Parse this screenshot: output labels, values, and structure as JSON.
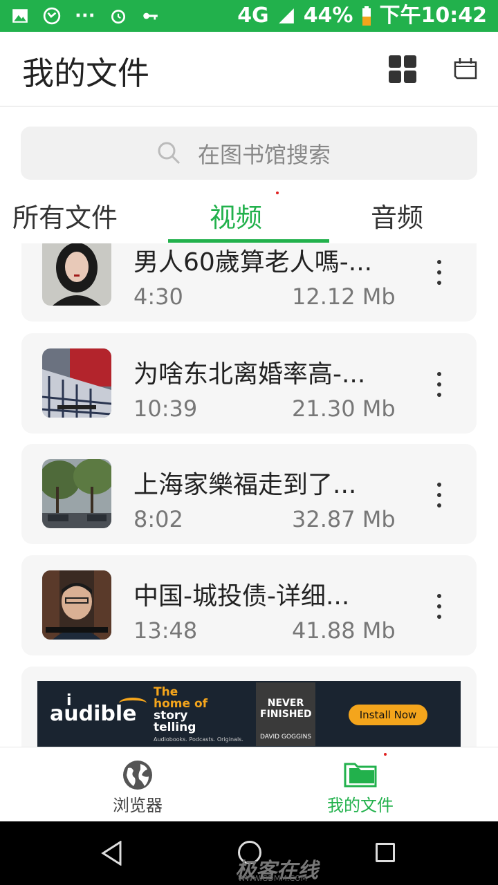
{
  "status_bar": {
    "network": "4G",
    "battery": "44%",
    "time": "下午10:42",
    "icons": [
      "image-icon",
      "phone-icon",
      "more-dots-icon",
      "alarm-icon",
      "key-icon",
      "signal-icon",
      "battery-icon"
    ],
    "color": "#22b14c"
  },
  "app_bar": {
    "title": "我的文件",
    "icons": [
      "grid-view-icon",
      "calendar-icon"
    ]
  },
  "search": {
    "placeholder": "在图书馆搜索",
    "icon": "search-icon"
  },
  "tabs": [
    {
      "label": "所有文件",
      "active": false
    },
    {
      "label": "视频",
      "active": true
    },
    {
      "label": "音频",
      "active": false
    }
  ],
  "files": [
    {
      "name": "男人60歲算老人嗎-...",
      "duration": "4:30",
      "size": "12.12 Mb"
    },
    {
      "name": "为啥东北离婚率高-...",
      "duration": "10:39",
      "size": "21.30 Mb"
    },
    {
      "name": "上海家樂福走到了...",
      "duration": "8:02",
      "size": "32.87 Mb"
    },
    {
      "name": "中国-城投债-详细...",
      "duration": "13:48",
      "size": "41.88 Mb"
    }
  ],
  "ad": {
    "brand": "audible",
    "tagline_1": "The",
    "tagline_2": "home of",
    "tagline_3": "story",
    "tagline_4": "telling",
    "sub": "Audiobooks. Podcasts. Originals.",
    "book_title": "NEVER FINISHED",
    "book_author": "DAVID GOGGINS",
    "cta": "Install Now"
  },
  "bottom_nav": [
    {
      "label": "浏览器",
      "icon": "globe-icon",
      "active": false
    },
    {
      "label": "我的文件",
      "icon": "folder-icon",
      "active": true
    }
  ],
  "watermark": {
    "text": "极客在线",
    "url": "WWW.GDMM.COM"
  },
  "accent_color": "#22b14c"
}
